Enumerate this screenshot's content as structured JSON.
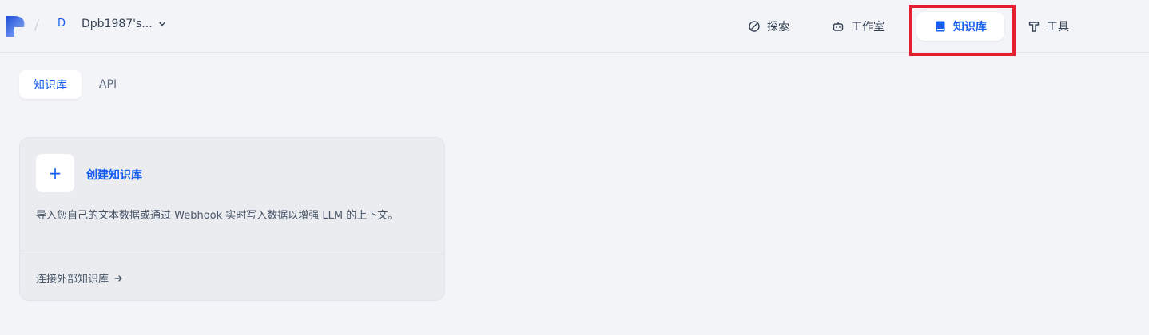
{
  "header": {
    "workspace_initial": "D",
    "workspace_name": "Dpb1987's...",
    "nav": {
      "explore": "探索",
      "studio": "工作室",
      "knowledge": "知识库",
      "tools": "工具"
    },
    "accent_color": "#155eef",
    "highlight_color": "#e5202e"
  },
  "tabs": {
    "knowledge": "知识库",
    "api": "API"
  },
  "create_card": {
    "plus": "+",
    "title": "创建知识库",
    "description": "导入您自己的文本数据或通过 Webhook 实时写入数据以增强 LLM 的上下文。",
    "connect_link": "连接外部知识库"
  }
}
